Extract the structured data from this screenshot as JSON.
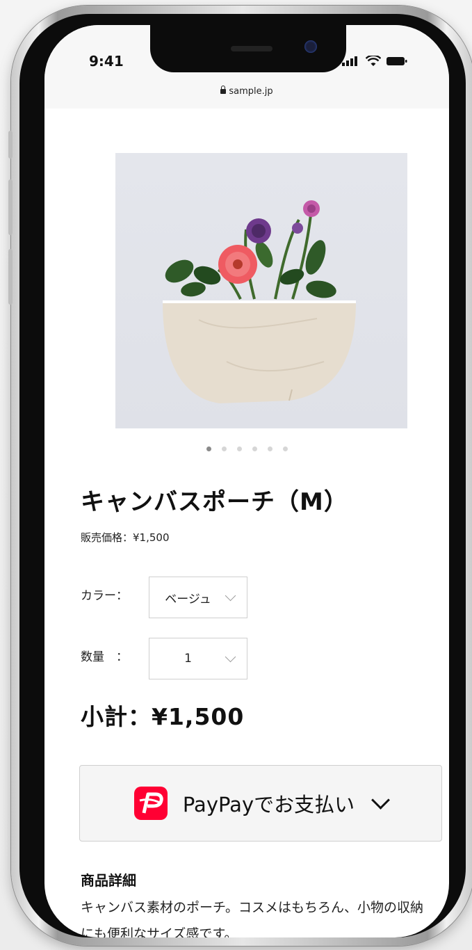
{
  "status_bar": {
    "time": "9:41",
    "url": "sample.jp"
  },
  "gallery": {
    "total_images": 6,
    "active_index": 0
  },
  "product": {
    "title": "キャンバスポーチ（M）",
    "price_label": "販売価格：¥1,500"
  },
  "options": {
    "color_label": "カラー：",
    "color_value": "ベージュ",
    "quantity_label": "数量　：",
    "quantity_value": "1"
  },
  "subtotal": "小計：¥1,500",
  "pay_button": {
    "label": "PayPayでお支払い"
  },
  "details": {
    "heading": "商品詳細",
    "text": "キャンバス素材のポーチ。コスメはもちろん、小物の収納にも便利なサイズ感です。"
  },
  "colors": {
    "paypay_red": "#ff0033",
    "pouch": "#e8ded0",
    "background": "#ffffff"
  }
}
